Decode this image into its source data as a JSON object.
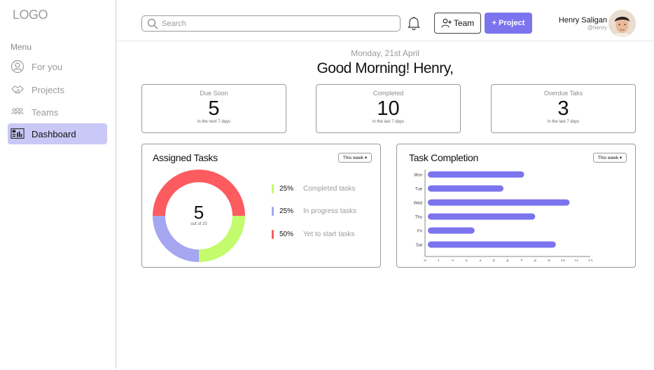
{
  "sidebar": {
    "logo": "LOGO",
    "menu_label": "Menu",
    "items": [
      {
        "label": "For you",
        "icon": "user-icon",
        "active": false
      },
      {
        "label": "Projects",
        "icon": "handshake-icon",
        "active": false
      },
      {
        "label": "Teams",
        "icon": "team-icon",
        "active": false
      },
      {
        "label": "Dashboard",
        "icon": "dashboard-icon",
        "active": true
      }
    ]
  },
  "header": {
    "search_placeholder": "Search",
    "team_label": "Team",
    "project_label": "+ Project",
    "user_name": "Henry Saligan",
    "user_handle": "@henry"
  },
  "greeting": {
    "date": "Monday, 21st April",
    "message": "Good Morning! Henry,"
  },
  "stats": [
    {
      "title": "Due Soon",
      "value": "5",
      "sub": "in the next 7 days"
    },
    {
      "title": "Completed",
      "value": "10",
      "sub": "in the last 7 days"
    },
    {
      "title": "Overdue Taks",
      "value": "3",
      "sub": "in the last 7 days"
    }
  ],
  "assigned": {
    "title": "Assigned Tasks",
    "period": "This week ▾",
    "center_value": "5",
    "center_sub": "out of 20",
    "legend": [
      {
        "pct": "25%",
        "label": "Completed tasks",
        "color": "#c2fb6b"
      },
      {
        "pct": "25%",
        "label": "In progress tasks",
        "color": "#a5a6f0"
      },
      {
        "pct": "50%",
        "label": "Yet to start tasks",
        "color": "#fc5b5f"
      }
    ]
  },
  "completion": {
    "title": "Task Completion",
    "period": "This week ▾"
  },
  "chart_data": [
    {
      "type": "pie",
      "categories": [
        "Completed tasks",
        "In progress tasks",
        "Yet to start tasks"
      ],
      "values": [
        25,
        25,
        50
      ],
      "colors": [
        "#c2fb6b",
        "#a5a6f0",
        "#fc5b5f"
      ]
    },
    {
      "type": "bar",
      "orientation": "horizontal",
      "categories": [
        "Mon",
        "Tue",
        "Wed",
        "Thu",
        "Fri",
        "Sat"
      ],
      "values": [
        7.2,
        5.7,
        10.5,
        8,
        3.6,
        9.5
      ],
      "xlim": [
        0,
        12
      ],
      "xticks": [
        "0",
        "1",
        "2",
        "3",
        "4",
        "5",
        "6",
        "7",
        "8",
        "9",
        "10",
        "11",
        "12"
      ],
      "color": "#7b74ee",
      "grid": false
    }
  ]
}
